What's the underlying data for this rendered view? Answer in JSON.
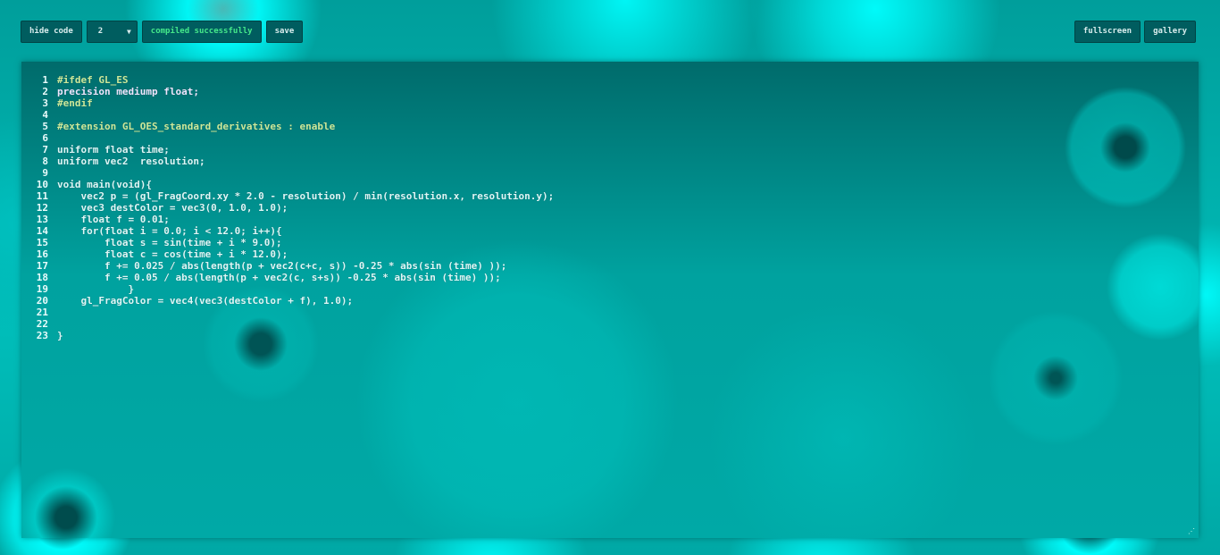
{
  "toolbar": {
    "hide_code_label": "hide code",
    "mode_value": "2",
    "mode_arrow": "▼",
    "status_text": "compiled successfully",
    "save_label": "save",
    "fullscreen_label": "fullscreen",
    "gallery_label": "gallery"
  },
  "colors": {
    "accent_status": "#45e88a",
    "button_bg": "#005d5f",
    "background": "#00b8b4"
  },
  "code": {
    "lines": [
      {
        "n": "1",
        "text": "#ifdef GL_ES",
        "kind": "pre"
      },
      {
        "n": "2",
        "text": "precision mediump float;",
        "kind": "kw"
      },
      {
        "n": "3",
        "text": "#endif",
        "kind": "pre"
      },
      {
        "n": "4",
        "text": "",
        "kind": "plain"
      },
      {
        "n": "5",
        "text": "#extension GL_OES_standard_derivatives : enable",
        "kind": "pre"
      },
      {
        "n": "6",
        "text": "",
        "kind": "plain"
      },
      {
        "n": "7",
        "text": "uniform float time;",
        "kind": "plain"
      },
      {
        "n": "8",
        "text": "uniform vec2  resolution;",
        "kind": "plain"
      },
      {
        "n": "9",
        "text": "",
        "kind": "plain"
      },
      {
        "n": "10",
        "text": "void main(void){",
        "kind": "plain"
      },
      {
        "n": "11",
        "text": "    vec2 p = (gl_FragCoord.xy * 2.0 - resolution) / min(resolution.x, resolution.y);",
        "kind": "plain"
      },
      {
        "n": "12",
        "text": "    vec3 destColor = vec3(0, 1.0, 1.0);",
        "kind": "plain"
      },
      {
        "n": "13",
        "text": "    float f = 0.01;",
        "kind": "plain"
      },
      {
        "n": "14",
        "text": "    for(float i = 0.0; i < 12.0; i++){",
        "kind": "plain"
      },
      {
        "n": "15",
        "text": "        float s = sin(time + i * 9.0);",
        "kind": "plain"
      },
      {
        "n": "16",
        "text": "        float c = cos(time + i * 12.0);",
        "kind": "plain"
      },
      {
        "n": "17",
        "text": "        f += 0.025 / abs(length(p + vec2(c+c, s)) -0.25 * abs(sin (time) ));",
        "kind": "plain"
      },
      {
        "n": "18",
        "text": "        f += 0.05 / abs(length(p + vec2(c, s+s)) -0.25 * abs(sin (time) ));",
        "kind": "plain"
      },
      {
        "n": "19",
        "text": "            }",
        "kind": "plain"
      },
      {
        "n": "20",
        "text": "    gl_FragColor = vec4(vec3(destColor + f), 1.0);",
        "kind": "plain"
      },
      {
        "n": "21",
        "text": "",
        "kind": "plain"
      },
      {
        "n": "22",
        "text": "",
        "kind": "plain"
      },
      {
        "n": "23",
        "text": "}",
        "kind": "plain"
      }
    ]
  },
  "editor": {
    "resize_glyph": "⋰"
  }
}
